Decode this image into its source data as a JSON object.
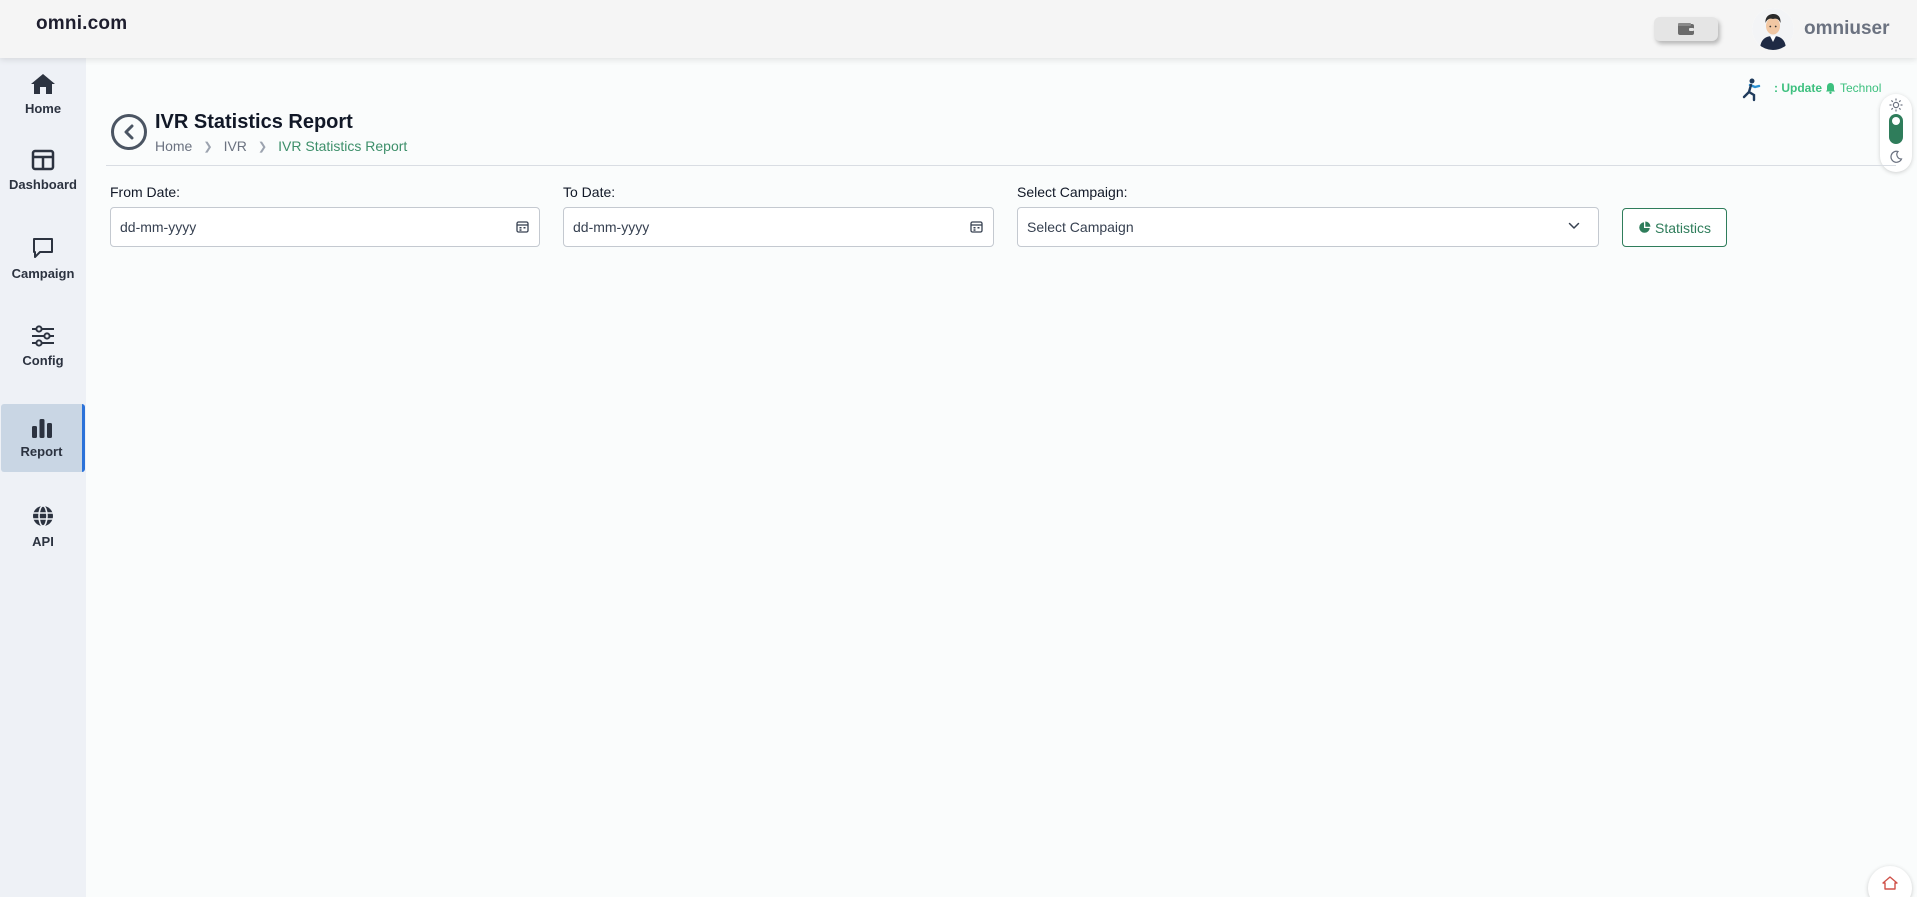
{
  "header": {
    "brand": "omni.com",
    "username": "omniuser",
    "wallet_icon": "wallet-icon",
    "avatar_icon": "user-avatar"
  },
  "sidebar": {
    "items": [
      {
        "label": "Home",
        "icon": "home-icon"
      },
      {
        "label": "Dashboard",
        "icon": "dashboard-icon"
      },
      {
        "label": "Campaign",
        "icon": "chat-icon"
      },
      {
        "label": "Config",
        "icon": "sliders-icon"
      },
      {
        "label": "Report",
        "icon": "bar-chart-icon",
        "active": true
      },
      {
        "label": "API",
        "icon": "globe-icon"
      }
    ]
  },
  "page": {
    "title": "IVR Statistics Report",
    "breadcrumb": [
      "Home",
      "IVR",
      "IVR Statistics Report"
    ]
  },
  "ticker": {
    "prefix": ": Update",
    "text": "Technol"
  },
  "filters": {
    "from_label": "From Date:",
    "from_value": "dd-mm-yyyy",
    "to_label": "To Date:",
    "to_value": "dd-mm-yyyy",
    "campaign_label": "Select Campaign:",
    "campaign_value": "Select Campaign",
    "statistics_button": "Statistics"
  },
  "colors": {
    "accent": "#2f7d5b",
    "ticker": "#3cc07e",
    "active_nav": "#c9d6e4",
    "active_nav_border": "#2b72d9"
  }
}
